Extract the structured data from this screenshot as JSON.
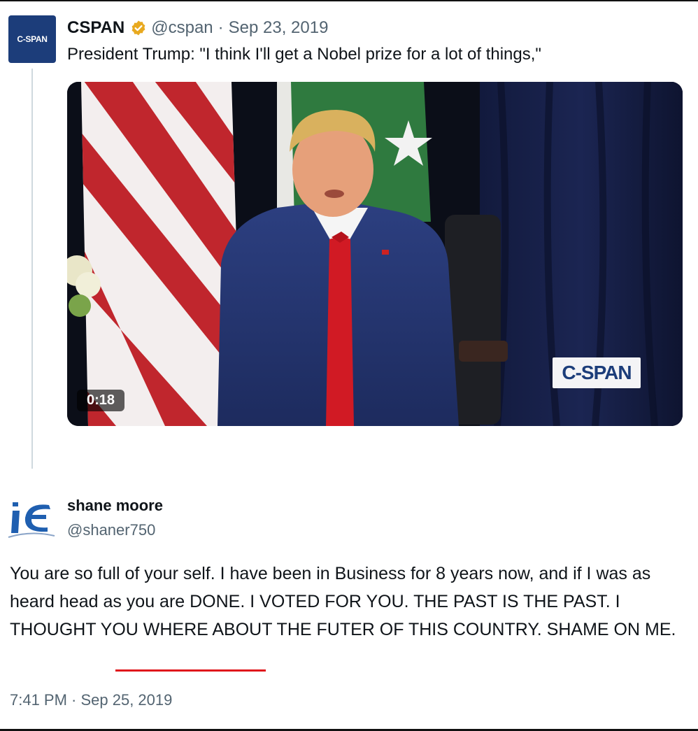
{
  "quoted_tweet": {
    "avatar_text": "C-SPAN",
    "name": "CSPAN",
    "verified_icon": "verified-badge-gold-icon",
    "handle": "@cspan",
    "separator": "·",
    "date": "Sep 23, 2019",
    "text": "President Trump: \"I think I'll get a Nobel prize for a lot of things,\"",
    "video": {
      "duration": "0:18",
      "watermark": "C-SPAN"
    }
  },
  "reply_tweet": {
    "name": "shane moore",
    "handle": "@shaner750",
    "text_before": "You are so full of your self. I have been in Business for 8 years now, and if I was as heard head as you are DONE. I VOTED FOR YOU. THE PAST IS THE PAST. I THOUGHT YOU WHERE ABOUT THE FUTER OF THIS COUNTRY. ",
    "text_emphasis": "SHAME ON ME.",
    "timestamp": "7:41 PM · Sep 25, 2019"
  },
  "colors": {
    "text_primary": "#0f1419",
    "text_secondary": "#536471",
    "verified_gold": "#e8a91f",
    "cspan_blue": "#1c3d7a",
    "annotation_red": "#e0171c"
  }
}
